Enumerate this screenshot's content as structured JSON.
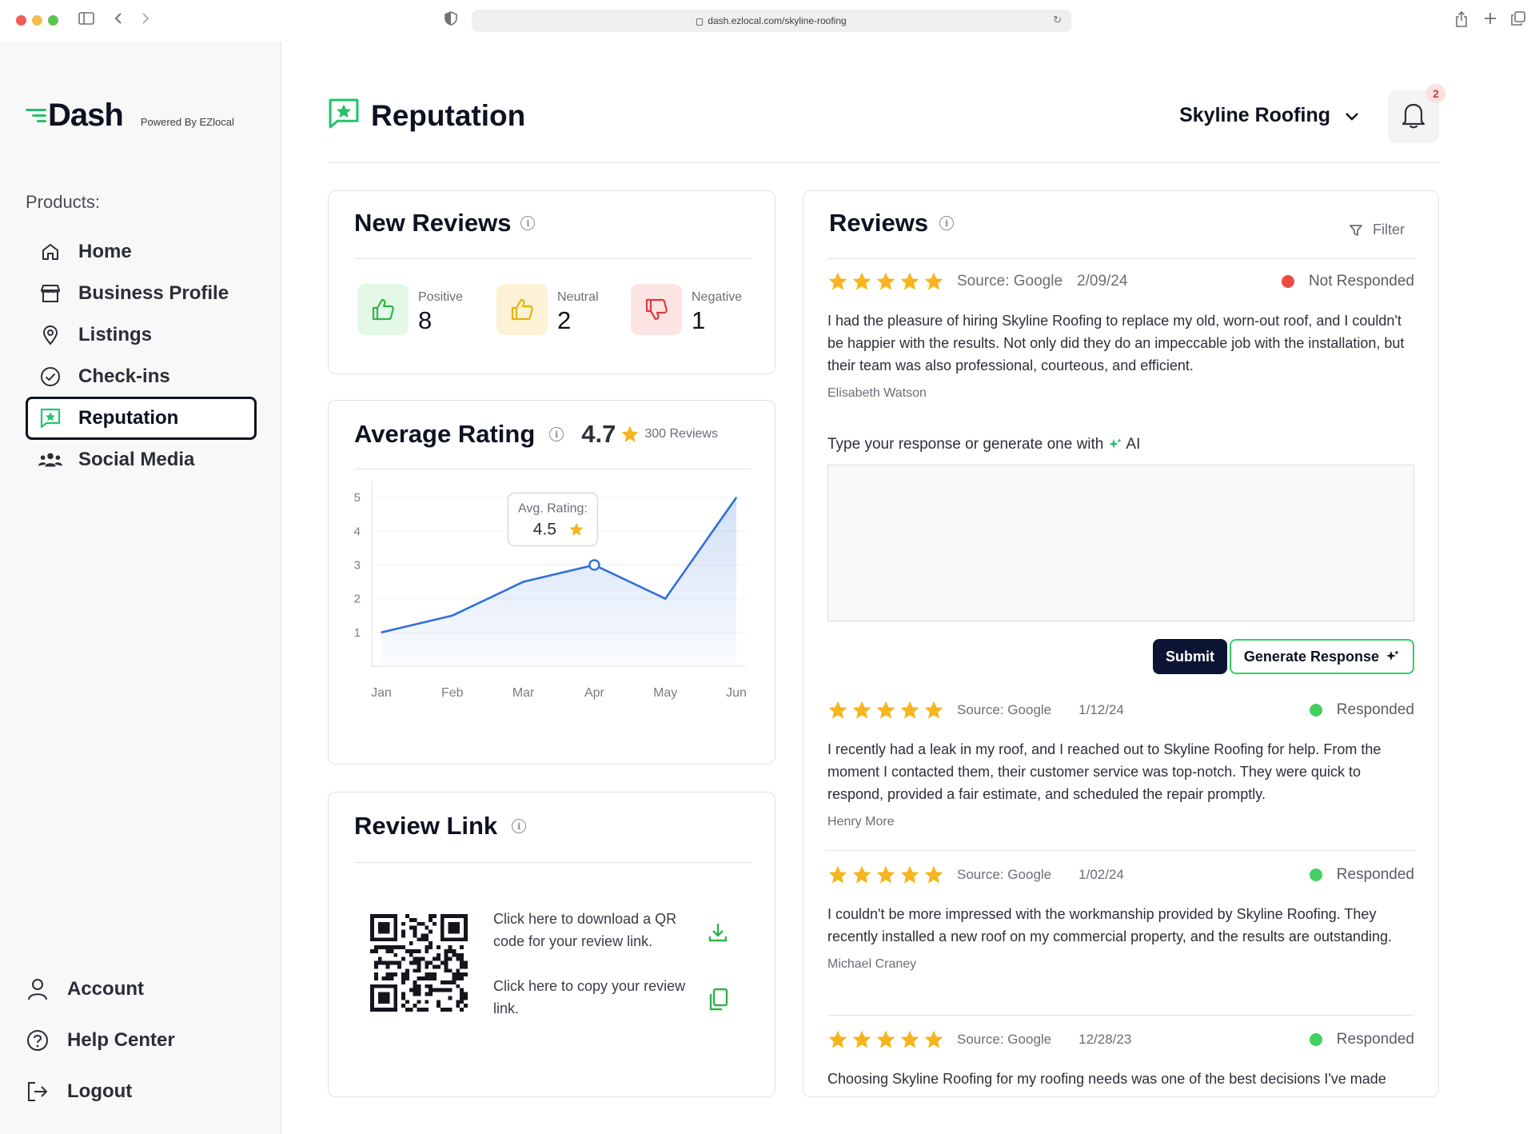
{
  "browser": {
    "url": "dash.ezlocal.com/skyline-roofing"
  },
  "brand": {
    "name": "Dash",
    "powered_by": "Powered By EZlocal",
    "accent": "#27c26a"
  },
  "sidebar": {
    "products_label": "Products:",
    "items": [
      {
        "label": "Home",
        "icon": "home-icon"
      },
      {
        "label": "Business Profile",
        "icon": "store-icon"
      },
      {
        "label": "Listings",
        "icon": "map-pin-icon"
      },
      {
        "label": "Check-ins",
        "icon": "check-circle-icon"
      },
      {
        "label": "Reputation",
        "icon": "reputation-icon",
        "active": true
      },
      {
        "label": "Social Media",
        "icon": "users-icon"
      }
    ],
    "bottom": [
      {
        "label": "Account",
        "icon": "user-icon"
      },
      {
        "label": "Help Center",
        "icon": "help-icon"
      },
      {
        "label": "Logout",
        "icon": "logout-icon"
      }
    ]
  },
  "header": {
    "title": "Reputation",
    "business": "Skyline Roofing",
    "notifications": "2"
  },
  "new_reviews": {
    "title": "New Reviews",
    "positive": {
      "label": "Positive",
      "value": "8",
      "color": "#2fb34a",
      "bg": "#e4f8e7"
    },
    "neutral": {
      "label": "Neutral",
      "value": "2",
      "color": "#e5b20d",
      "bg": "#fdf2d6"
    },
    "negative": {
      "label": "Negative",
      "value": "1",
      "color": "#de3b3b",
      "bg": "#fde4e4"
    }
  },
  "average_rating": {
    "title": "Average Rating",
    "value": "4.7",
    "count": "300 Reviews",
    "tooltip_label": "Avg. Rating:",
    "tooltip_value": "4.5"
  },
  "chart_data": {
    "type": "area",
    "categories": [
      "Jan",
      "Feb",
      "Mar",
      "Apr",
      "May",
      "Jun"
    ],
    "values": [
      1,
      1.5,
      2.5,
      3,
      2,
      5
    ],
    "ylim": [
      0,
      5.5
    ],
    "yticks": [
      1,
      2,
      3,
      4,
      5
    ],
    "highlight_index": 3,
    "grid": true,
    "color": "#2f6fdb"
  },
  "review_link": {
    "title": "Review Link",
    "download_text": "Click here to download a QR code for your review link.",
    "copy_text": "Click here to copy your review link."
  },
  "reviews": {
    "title": "Reviews",
    "filter_label": "Filter",
    "response_label": "Type your response or generate one with",
    "ai_label": "AI",
    "submit_label": "Submit",
    "generate_label": "Generate Response",
    "star_color": "#f6b51e",
    "items": [
      {
        "source": "Source: Google",
        "date": "2/09/24",
        "status": "Not Responded",
        "status_color": "#ef4b45",
        "rating": 5,
        "text": "I had the pleasure of hiring Skyline Roofing to replace my old, worn-out roof, and I couldn't be happier with the results. Not only did they do an impeccable job with the installation, but their team was also professional, courteous, and efficient.",
        "author": "Elisabeth Watson"
      },
      {
        "source": "Source: Google",
        "date": "1/12/24",
        "status": "Responded",
        "status_color": "#43d062",
        "rating": 5,
        "text": "I recently had a leak in my roof, and I reached out to Skyline Roofing for help. From the moment I contacted them, their customer service was top-notch. They were quick to respond, provided a fair estimate, and scheduled the repair promptly.",
        "author": "Henry More"
      },
      {
        "source": "Source: Google",
        "date": "1/02/24",
        "status": "Responded",
        "status_color": "#43d062",
        "rating": 5,
        "text": "I couldn't be more impressed with the workmanship provided by Skyline Roofing. They recently installed a new roof on my commercial property, and the results are outstanding.",
        "author": "Michael Craney"
      },
      {
        "source": "Source: Google",
        "date": "12/28/23",
        "status": "Responded",
        "status_color": "#43d062",
        "rating": 5,
        "text": "Choosing Skyline Roofing for my roofing needs was one of the best decisions I've made",
        "author": ""
      }
    ]
  }
}
